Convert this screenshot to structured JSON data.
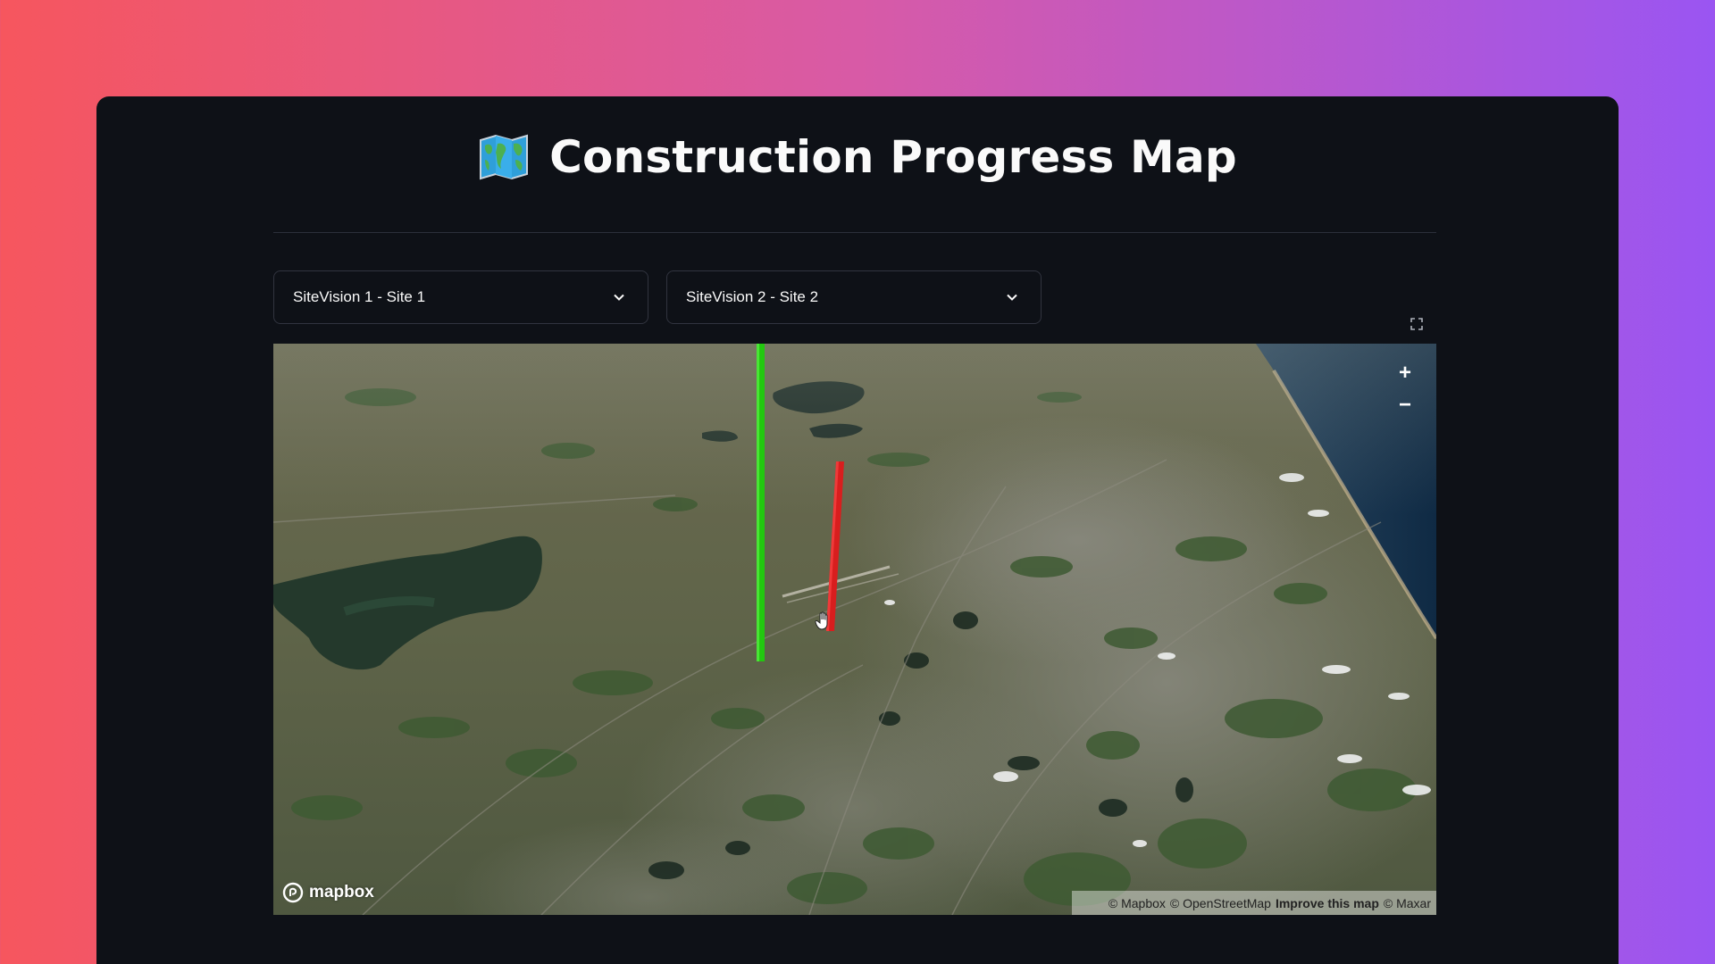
{
  "page": {
    "title": "Construction Progress Map",
    "title_icon": "world-map-icon"
  },
  "selectors": [
    {
      "value": "SiteVision 1 - Site 1",
      "icon": "chevron-down-icon"
    },
    {
      "value": "SiteVision 2 - Site 2",
      "icon": "chevron-down-icon"
    }
  ],
  "map": {
    "provider_logo": "mapbox",
    "attribution": {
      "mapbox": "© Mapbox",
      "osm": "© OpenStreetMap",
      "improve": "Improve this map",
      "maxar": "© Maxar"
    },
    "controls": {
      "zoom_in": "+",
      "zoom_out": "−"
    },
    "markers": [
      {
        "site": "Site 1",
        "color": "#22c80f"
      },
      {
        "site": "Site 2",
        "color": "#d81e1e"
      }
    ]
  },
  "colors": {
    "window_bg": "#0e1117",
    "text": "#fafafa",
    "border": "#31343f",
    "gradient_left": "#f6565e",
    "gradient_right": "#9a55f2"
  }
}
